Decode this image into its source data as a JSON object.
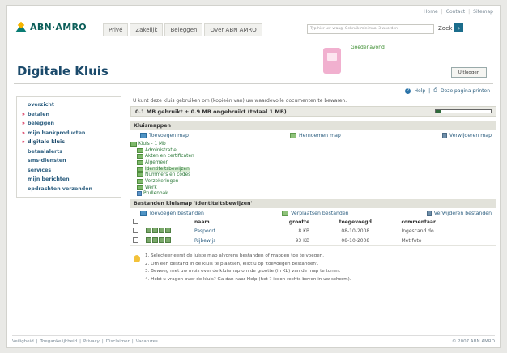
{
  "top_links": [
    "Home",
    "Contact",
    "Sitemap"
  ],
  "brand": {
    "name": "ABN·AMRO",
    "teal": "#0a7c74",
    "yellow": "#f5b400"
  },
  "nav": [
    "Privé",
    "Zakelijk",
    "Beleggen",
    "Over ABN AMRO"
  ],
  "search": {
    "placeholder": "Typ hier uw vraag. Gebruik minimaal 3 woorden.",
    "button_label": "Zoek"
  },
  "header": {
    "title": "Digitale Kluis",
    "greeting": "Goedenavond",
    "logout_label": "Uitloggen",
    "help_label": "Help",
    "print_label": "Deze pagina printen"
  },
  "sidebar": {
    "items": [
      {
        "label": "overzicht",
        "bullet": ""
      },
      {
        "label": "betalen",
        "bullet": "»"
      },
      {
        "label": "beleggen",
        "bullet": "»"
      },
      {
        "label": "mijn bankproducten",
        "bullet": "»"
      },
      {
        "label": "digitale kluis",
        "bullet": "»"
      },
      {
        "label": "betaalalerts",
        "bullet": ""
      },
      {
        "label": "sms-diensten",
        "bullet": ""
      },
      {
        "label": "services",
        "bullet": ""
      },
      {
        "label": "mijn berichten",
        "bullet": ""
      },
      {
        "label": "opdrachten verzenden",
        "bullet": ""
      }
    ]
  },
  "content": {
    "intro": "U kunt deze kluis gebruiken om (kopieën van) uw waardevolle documenten te bewaren.",
    "usage_text": "0.1 MB gebruikt + 0.9 MB ongebruikt (totaal 1 MB)",
    "usage_fraction": 0.1,
    "folders_section": {
      "title": "Kluismappen",
      "actions": {
        "add": "Toevoegen map",
        "rename": "Hernoemen map",
        "delete": "Verwijderen map"
      },
      "root": "Kluis - 1 Mb",
      "children": [
        "Administratie",
        "Akten en certificaten",
        "Algemeen",
        "Identiteitsbewijzen",
        "Nummers en codes",
        "Verzekeringen",
        "Werk",
        "Prullenbak"
      ],
      "selected": "Identiteitsbewijzen"
    },
    "files_section": {
      "title": "Bestanden kluismap 'Identiteitsbewijzen'",
      "actions": {
        "add": "Toevoegen bestanden",
        "move": "Verplaatsen bestanden",
        "delete": "Verwijderen bestanden"
      },
      "columns": {
        "name": "naam",
        "size": "grootte",
        "added": "toegevoegd",
        "comment": "commentaar"
      },
      "rows": [
        {
          "name": "Paspoort",
          "size": "8 KB",
          "added": "08-10-2008",
          "comment": "Ingescand do..."
        },
        {
          "name": "Rijbewijs",
          "size": "93 KB",
          "added": "08-10-2008",
          "comment": "Met foto"
        }
      ]
    },
    "tips": [
      "1. Selecteer eerst de juiste map alvorens bestanden of mappen toe te voegen.",
      "2. Om een bestand in de kluis te plaatsen, klikt u op 'toevoegen bestanden'.",
      "3. Beweeg met uw muis over de kluismap om de grootte (in Kb) van de map te tonen.",
      "4. Hebt u vragen over de kluis? Ga dan naar Help (het ? icoon rechts boven in uw scherm)."
    ]
  },
  "footer": {
    "links": [
      "Veiligheid",
      "Toegankelijkheid",
      "Privacy",
      "Disclaimer",
      "Vacatures"
    ],
    "copyright": "© 2007 ABN AMRO"
  }
}
